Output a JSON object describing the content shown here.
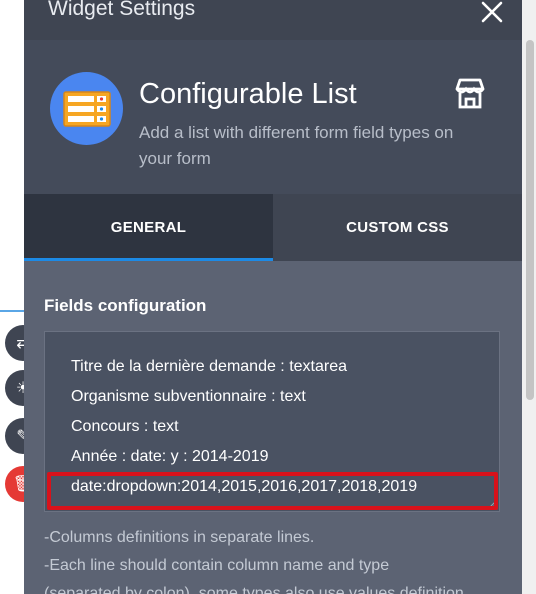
{
  "header_bar": {
    "title": "Widget Settings"
  },
  "widget": {
    "name": "Configurable List",
    "description": "Add a list with different form field types on your form",
    "icon_color": "#4a86f0"
  },
  "tabs": [
    {
      "label": "GENERAL",
      "active": true
    },
    {
      "label": "CUSTOM CSS",
      "active": false
    }
  ],
  "fields_config": {
    "label": "Fields configuration",
    "lines": [
      "Titre de la dernière demande : textarea",
      "Organisme subventionnaire : text",
      "Concours  : text",
      "Année : date: y : 2014-2019",
      "date:dropdown:2014,2015,2016,2017,2018,2019"
    ],
    "highlight_color": "#d8121b"
  },
  "hints": [
    "-Columns definitions in separate lines.",
    "-Each line should contain column name and type",
    "(separated by colon), some types also use values definition"
  ],
  "colors": {
    "accent": "#1c8ae6",
    "panel": "#5c6373",
    "header": "#444b5a"
  }
}
